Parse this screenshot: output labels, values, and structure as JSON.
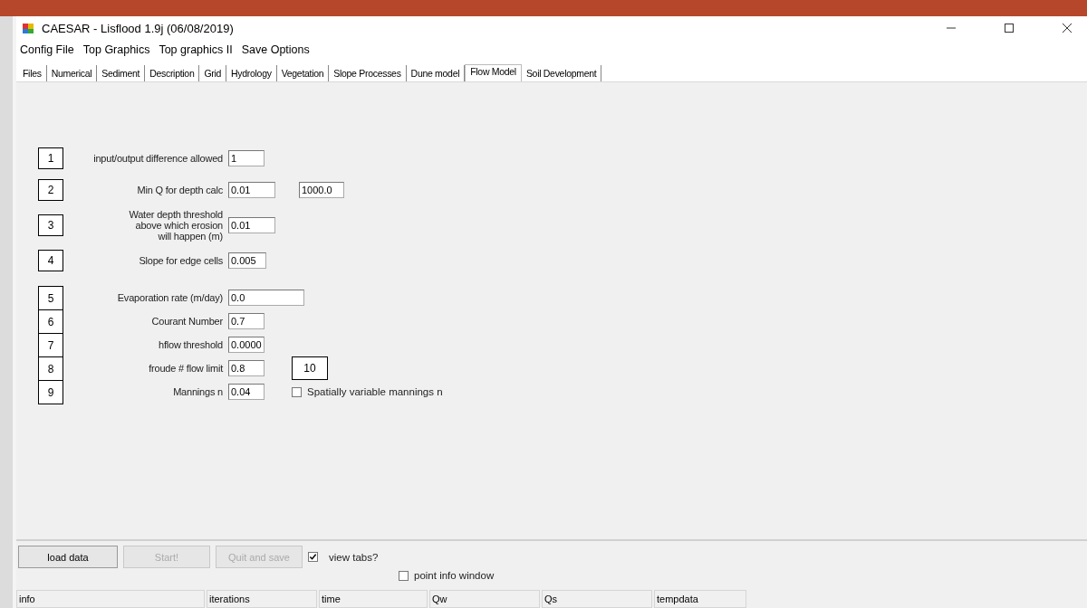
{
  "window": {
    "title": "CAESAR - Lisflood 1.9j (06/08/2019)"
  },
  "menu": [
    "Config File",
    "Top Graphics",
    "Top graphics II",
    "Save Options"
  ],
  "tabs": [
    {
      "label": "Files",
      "selected": false
    },
    {
      "label": "Numerical",
      "selected": false
    },
    {
      "label": "Sediment",
      "selected": false
    },
    {
      "label": "Description",
      "selected": false
    },
    {
      "label": "Grid",
      "selected": false
    },
    {
      "label": "Hydrology",
      "selected": false
    },
    {
      "label": "Vegetation",
      "selected": false
    },
    {
      "label": "Slope Processes",
      "selected": false
    },
    {
      "label": "Dune model",
      "selected": false
    },
    {
      "label": "Flow Model",
      "selected": true
    },
    {
      "label": "Soil Development",
      "selected": false
    }
  ],
  "upper_fields": [
    {
      "number": "1",
      "label": "input/output difference allowed",
      "value": "1"
    },
    {
      "number": "2",
      "label": "Min Q for depth calc",
      "value": "0.01",
      "extra_value": "1000.0"
    },
    {
      "number": "3",
      "label": "Water depth threshold above which erosion will happen (m)",
      "value": "0.01"
    },
    {
      "number": "4",
      "label": "Slope for edge cells",
      "value": "0.005"
    }
  ],
  "lower_fields": [
    {
      "number": "5",
      "label": "Evaporation rate (m/day)",
      "value": "0.0"
    },
    {
      "number": "6",
      "label": "Courant Number",
      "value": "0.7"
    },
    {
      "number": "7",
      "label": "hflow threshold",
      "value": "0.0000"
    },
    {
      "number": "8",
      "label": "froude # flow limit",
      "value": "0.8",
      "side_number": "10"
    },
    {
      "number": "9",
      "label": "Mannings n",
      "value": "0.04",
      "checkbox": {
        "label": "Spatially variable mannings n",
        "checked": false
      }
    }
  ],
  "buttons": [
    {
      "label": "load data",
      "disabled": false
    },
    {
      "label": "Start!",
      "disabled": true
    },
    {
      "label": "Quit and save",
      "disabled": true
    }
  ],
  "view_tabs": {
    "label": "view tabs?",
    "checked": true
  },
  "point_info": {
    "label": "point info window",
    "checked": false
  },
  "status_bar": [
    "info",
    "iterations",
    "time",
    "Qw",
    "Qs",
    "tempdata"
  ]
}
